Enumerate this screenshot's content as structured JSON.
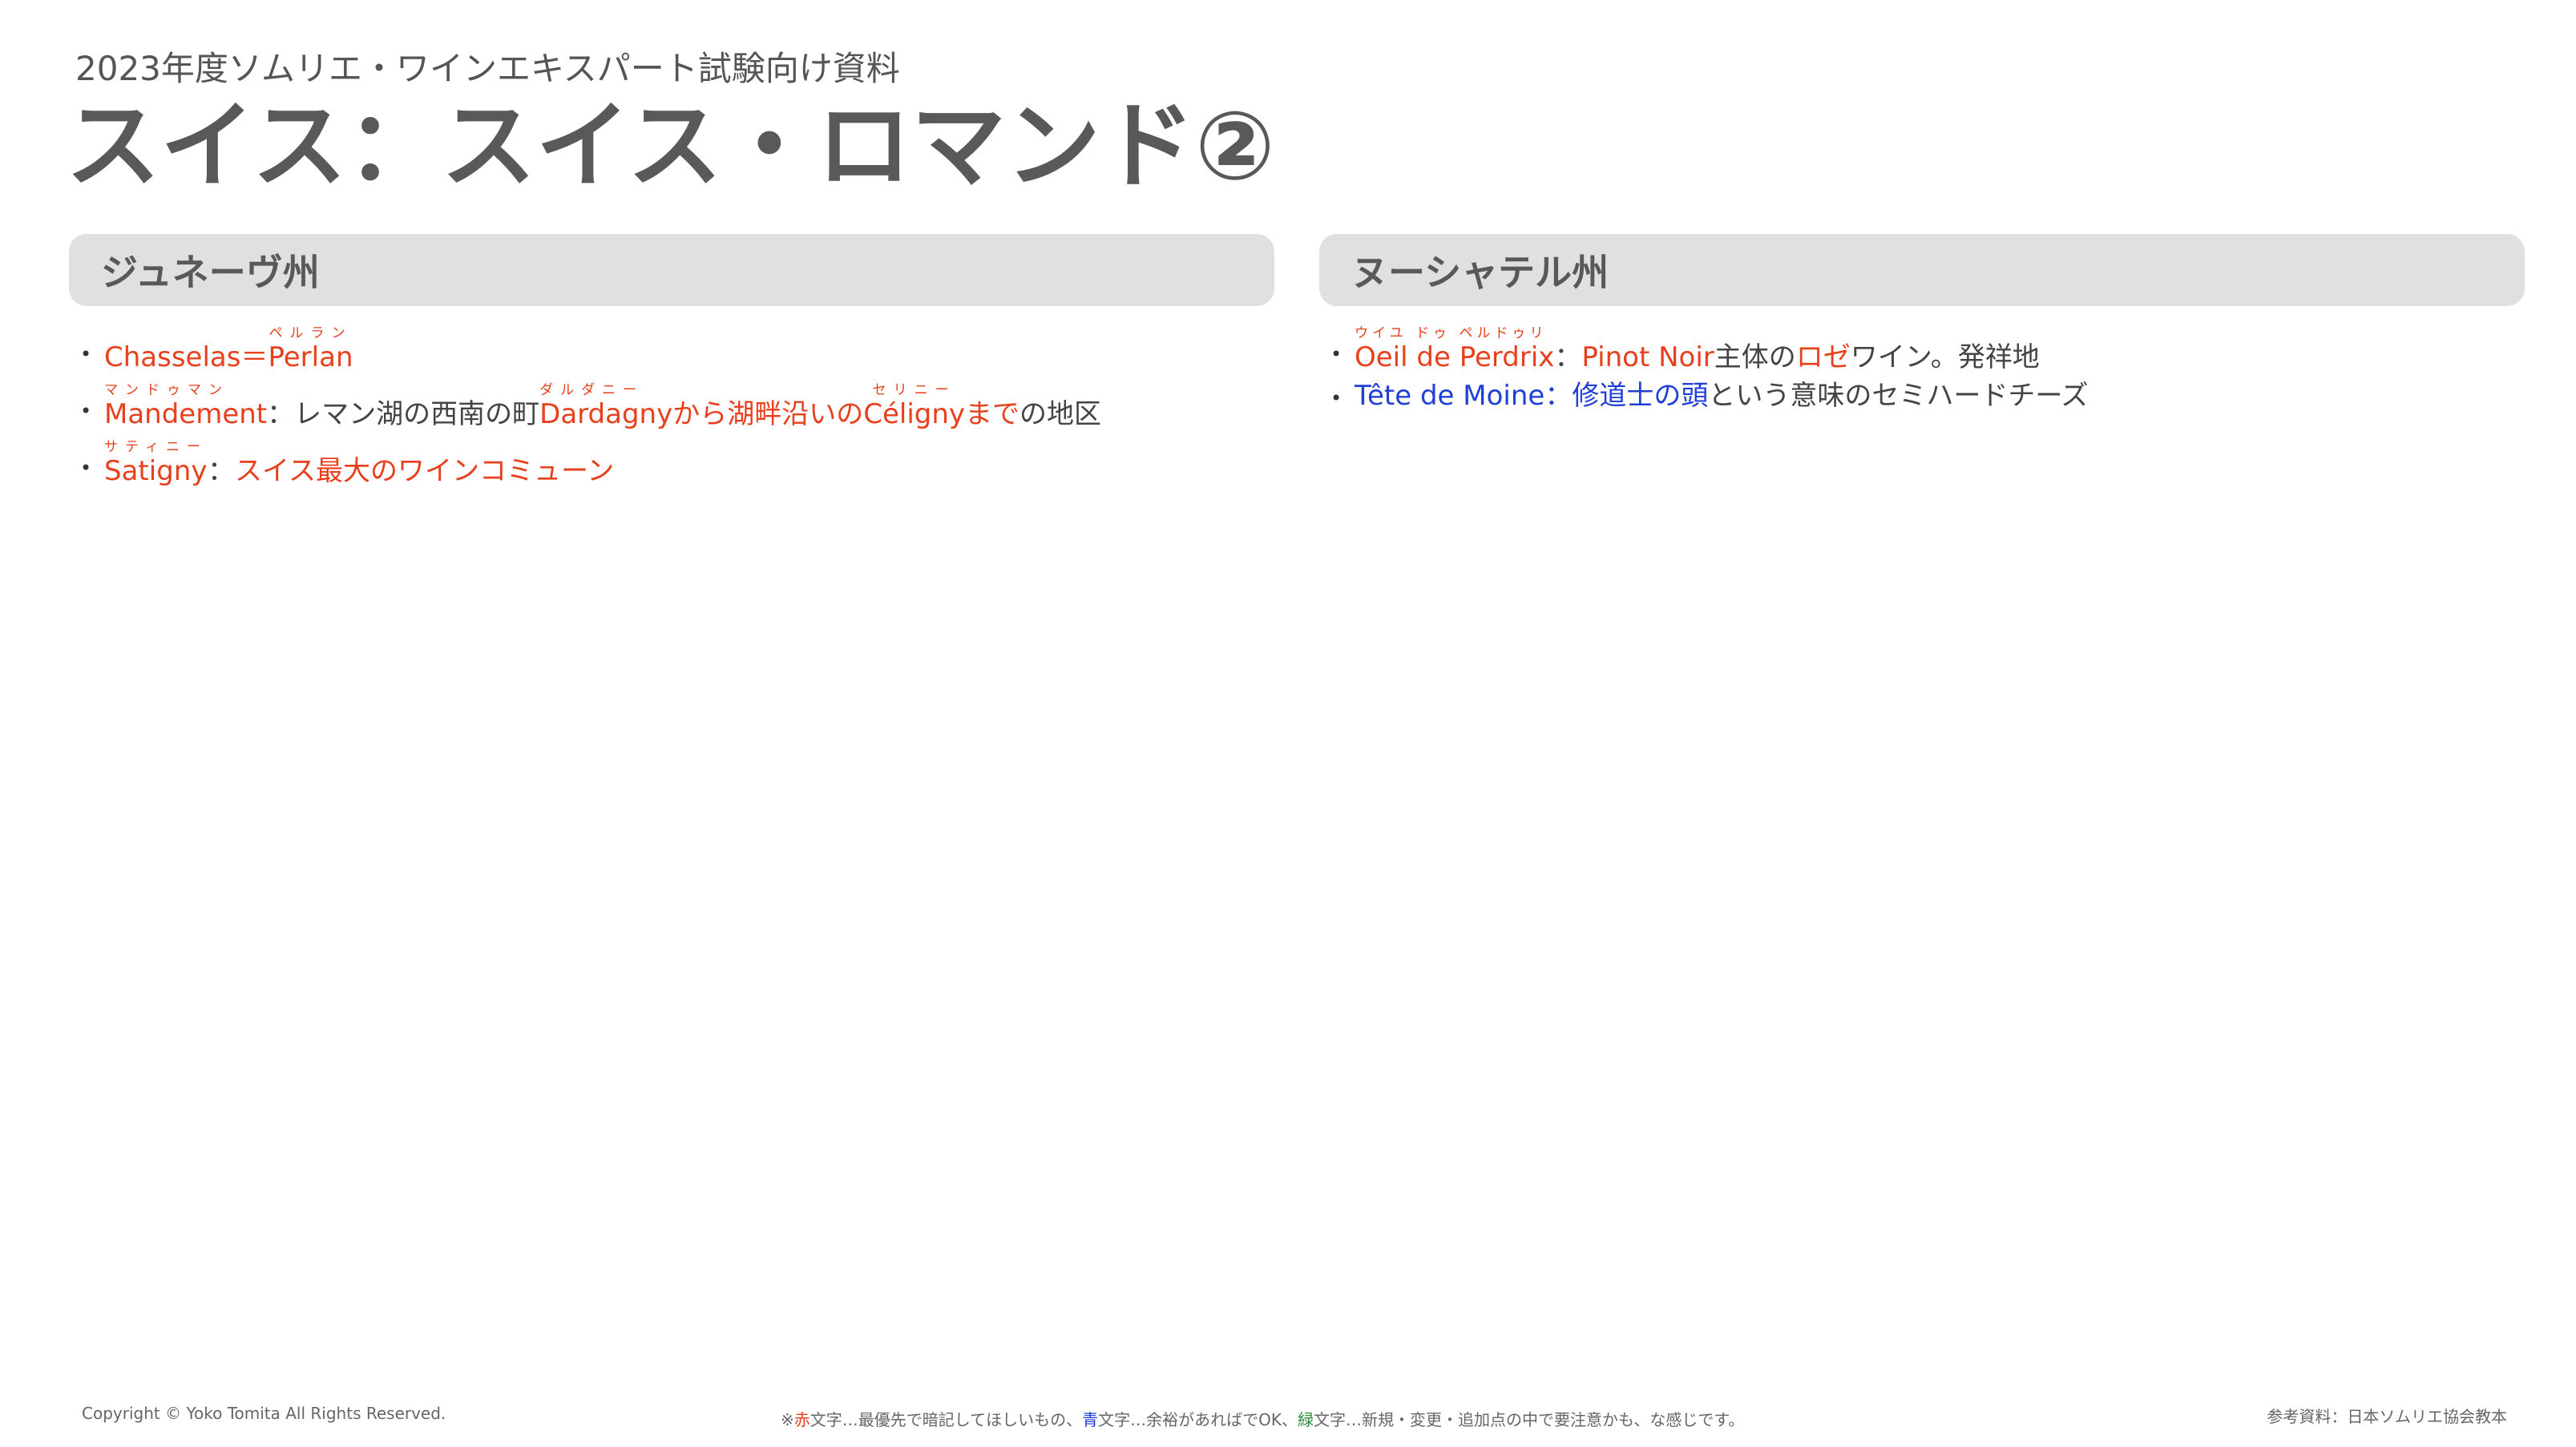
{
  "header": {
    "subtitle": "2023年度ソムリエ・ワインエキスパート試験向け資料",
    "title": "スイス：スイス・ロマンド②"
  },
  "left_panel": {
    "heading": "ジュネーヴ州",
    "items": [
      {
        "bullet": "•",
        "term": "Chasselas",
        "term_reading": "",
        "eq": "＝",
        "term2": "Perlan",
        "term2_reading": "ペルラン"
      },
      {
        "bullet": "•",
        "term": "Mandement",
        "term_reading": "マンドゥマン",
        "sep": "：",
        "text1": "レマン湖の西南の町",
        "place1": "Dardagny",
        "place1_reading": "ダルダニー",
        "text2": "から湖畔沿いの",
        "place2": "Céligny",
        "place2_reading": "セリニー",
        "text3": "まで",
        "text4": "の地区"
      },
      {
        "bullet": "•",
        "term": "Satigny",
        "term_reading": "サティニー",
        "sep": "：",
        "text1": "スイス最大のワインコミューン"
      }
    ]
  },
  "right_panel": {
    "heading": "ヌーシャテル州",
    "items": [
      {
        "bullet": "•",
        "term": "Oeil de Perdrix",
        "term_reading": "ウイユ ドゥ ペルドゥリ",
        "sep": "：",
        "term2": "Pinot Noir",
        "text1": "主体の",
        "text2": "ロゼ",
        "text3": "ワイン。発祥地"
      },
      {
        "bullet": "•",
        "term": "Tête de Moine",
        "sep": "：",
        "text1": "修道士の頭",
        "text2": "という意味のセミハードチーズ"
      }
    ]
  },
  "footer": {
    "copyright": "Copyright © Yoko Tomita All Rights Reserved.",
    "legend": {
      "prefix": "※",
      "red_word": "赤",
      "red_desc": "文字…最優先で暗記してほしいもの、",
      "blue_word": "青",
      "blue_desc": "文字…余裕があればでOK、",
      "green_word": "緑",
      "green_desc": "文字…新規・変更・追加点の中で要注意かも、な感じです。"
    },
    "reference": "参考資料：日本ソムリエ協会教本"
  },
  "colors": {
    "red": "#e8401c",
    "blue": "#1f3fd6",
    "green": "#2e8b3a",
    "header_bg": "#e0e0e0",
    "title_text": "#595959"
  }
}
